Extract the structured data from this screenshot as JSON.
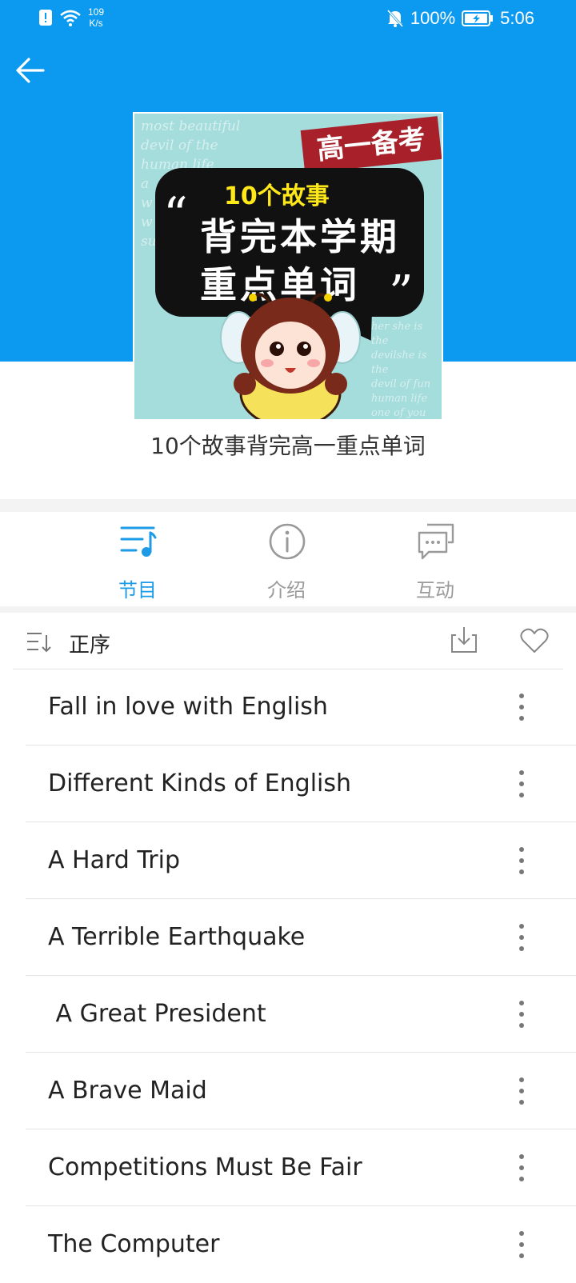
{
  "status_bar": {
    "speed_value": "109",
    "speed_unit": "K/s",
    "battery": "100%",
    "time": "5:06"
  },
  "album": {
    "cover": {
      "tag": "高一备考",
      "bubble_sub": "10个故事",
      "line1": "背完本学期",
      "line2": "重点单词"
    },
    "title": "10个故事背完高一重点单词"
  },
  "tabs": [
    {
      "label": "节目",
      "active": true
    },
    {
      "label": "介绍",
      "active": false
    },
    {
      "label": "互动",
      "active": false
    }
  ],
  "sort": {
    "label": "正序"
  },
  "episodes": [
    {
      "title": "Fall in love with English"
    },
    {
      "title": "Different Kinds of English"
    },
    {
      "title": "A Hard Trip"
    },
    {
      "title": "A Terrible Earthquake"
    },
    {
      "title": " A Great President"
    },
    {
      "title": "A Brave Maid"
    },
    {
      "title": "Competitions Must Be Fair"
    },
    {
      "title": "The Computer"
    }
  ],
  "colors": {
    "header_blue": "#0b9aef",
    "active_tab": "#1e9be6",
    "inactive_tab": "#9a9a9a"
  }
}
